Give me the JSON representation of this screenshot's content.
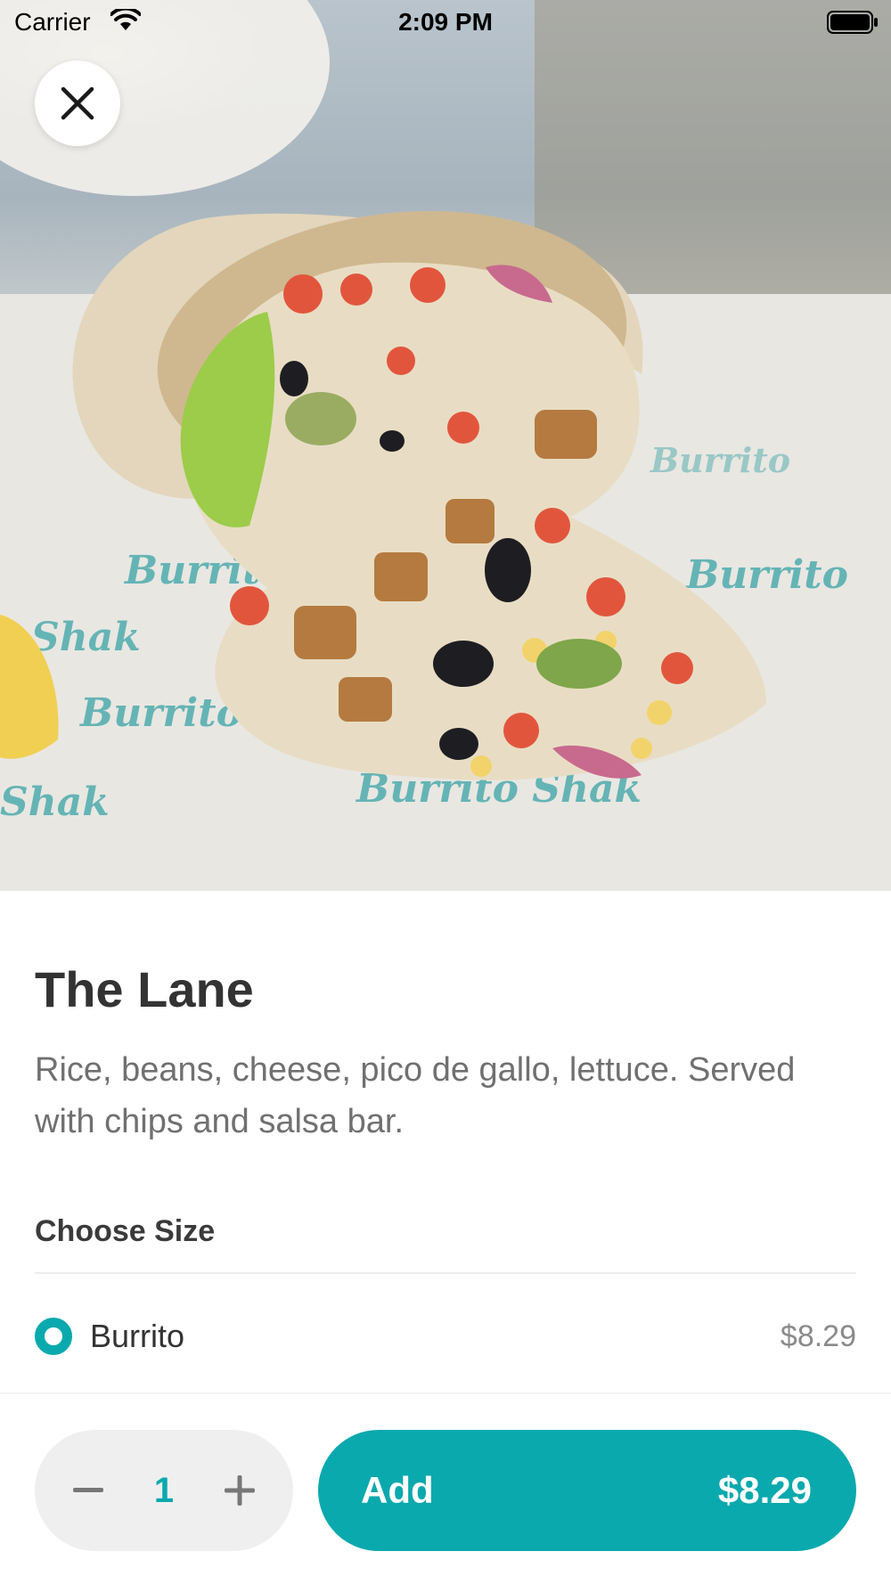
{
  "status_bar": {
    "carrier": "Carrier",
    "time": "2:09 PM"
  },
  "hero": {
    "image_icon": "burrito-photo",
    "wrapper_text": [
      "Burrito",
      "Shak",
      "Burrito Shak"
    ]
  },
  "product": {
    "title": "The Lane",
    "description": "Rice, beans, cheese, pico de gallo, lettuce. Served with chips and salsa bar."
  },
  "size_section": {
    "title": "Choose Size",
    "options": [
      {
        "label": "Burrito",
        "price": "$8.29",
        "selected": true
      }
    ]
  },
  "bottom_bar": {
    "quantity": "1",
    "add_label": "Add",
    "add_price": "$8.29"
  },
  "colors": {
    "accent": "#0aa9ad",
    "text_primary": "#333333",
    "text_secondary": "#707070",
    "stepper_bg": "#efefef"
  }
}
